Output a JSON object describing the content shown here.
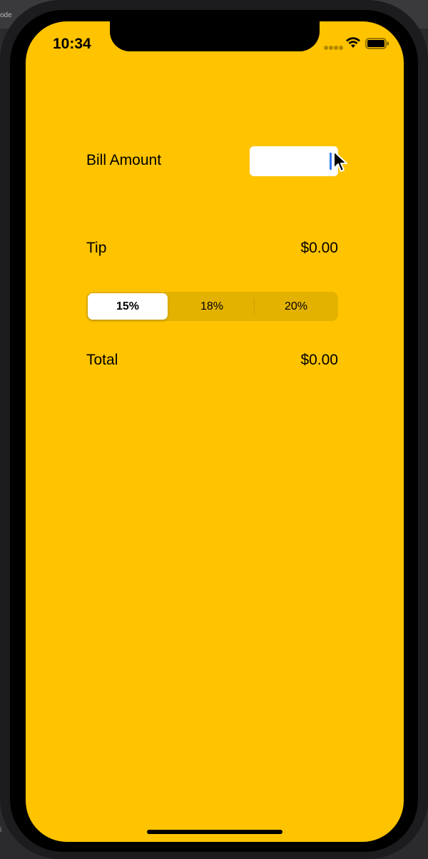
{
  "host": {
    "strip_text": "ode",
    "strip_text_bottom": "i"
  },
  "status_bar": {
    "time": "10:34",
    "icons": [
      "cellular-signal-icon",
      "wifi-icon",
      "battery-icon"
    ]
  },
  "bill": {
    "label": "Bill Amount",
    "value": "",
    "placeholder": ""
  },
  "tip": {
    "label": "Tip",
    "value": "$0.00"
  },
  "tip_selector": {
    "options": [
      "15%",
      "18%",
      "20%"
    ],
    "selected": "15%"
  },
  "total": {
    "label": "Total",
    "value": "$0.00"
  },
  "colors": {
    "background": "#ffc300",
    "segment_track": "#e3b200",
    "caret": "#3478f6"
  }
}
